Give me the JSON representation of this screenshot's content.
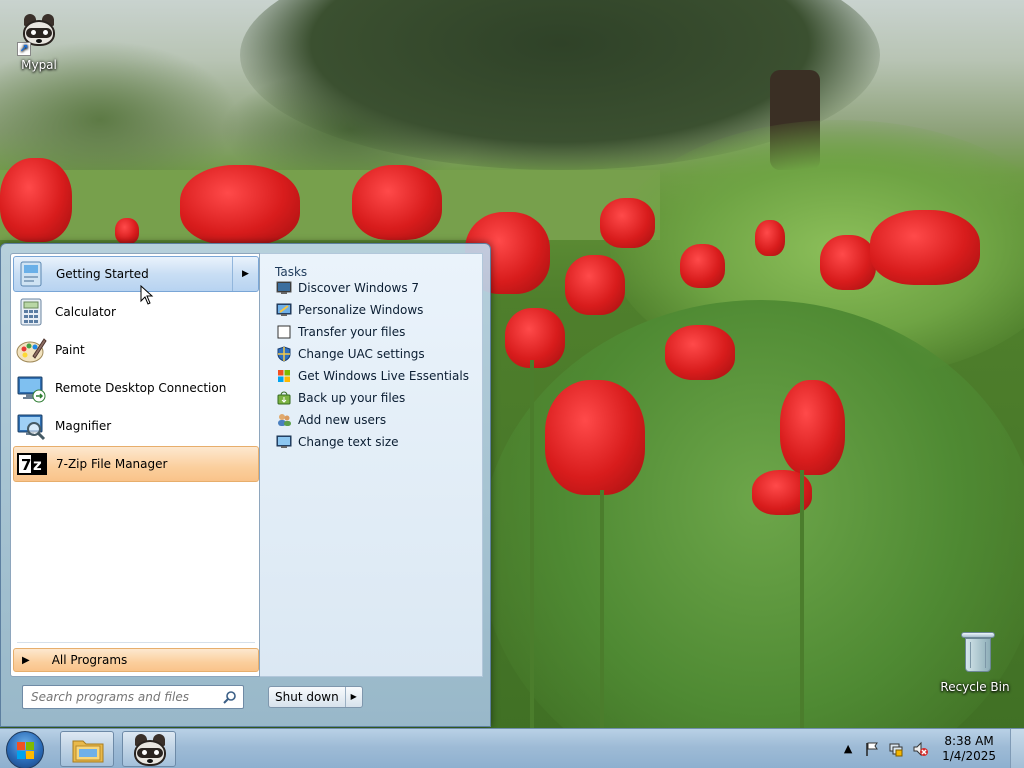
{
  "desktop": {
    "icons": [
      {
        "label": "Mypal",
        "icon": "mypal-raccoon-icon"
      },
      {
        "label": "Recycle Bin",
        "icon": "recycle-bin-icon"
      }
    ]
  },
  "start_menu": {
    "programs": [
      {
        "label": "Getting Started",
        "icon": "getting-started-icon",
        "state": "hover",
        "has_submenu": true
      },
      {
        "label": "Calculator",
        "icon": "calculator-icon"
      },
      {
        "label": "Paint",
        "icon": "paint-icon"
      },
      {
        "label": "Remote Desktop Connection",
        "icon": "remote-desktop-icon"
      },
      {
        "label": "Magnifier",
        "icon": "magnifier-icon"
      },
      {
        "label": "7-Zip File Manager",
        "icon": "7zip-icon",
        "state": "highlighted"
      }
    ],
    "all_programs_label": "All Programs",
    "search_placeholder": "Search programs and files",
    "shutdown_label": "Shut down",
    "tasks": {
      "title": "Tasks",
      "items": [
        {
          "label": "Discover Windows 7",
          "icon": "discover-icon"
        },
        {
          "label": "Personalize Windows",
          "icon": "personalize-icon"
        },
        {
          "label": "Transfer your files",
          "icon": "transfer-icon"
        },
        {
          "label": "Change UAC settings",
          "icon": "uac-shield-icon"
        },
        {
          "label": "Get Windows Live Essentials",
          "icon": "windows-flag-icon"
        },
        {
          "label": "Back up your files",
          "icon": "backup-icon"
        },
        {
          "label": "Add new users",
          "icon": "users-icon"
        },
        {
          "label": "Change text size",
          "icon": "monitor-icon"
        }
      ]
    }
  },
  "taskbar": {
    "pinned": [
      {
        "name": "windows-explorer",
        "icon": "folder-icon"
      },
      {
        "name": "mypal",
        "icon": "mypal-raccoon-icon"
      }
    ],
    "clock": {
      "time": "8:38 AM",
      "date": "1/4/2025"
    }
  },
  "colors": {
    "hover_blue": "#c9def4",
    "highlight_orange": "#fbcf9d",
    "taskbar": "#9ebbd6"
  }
}
